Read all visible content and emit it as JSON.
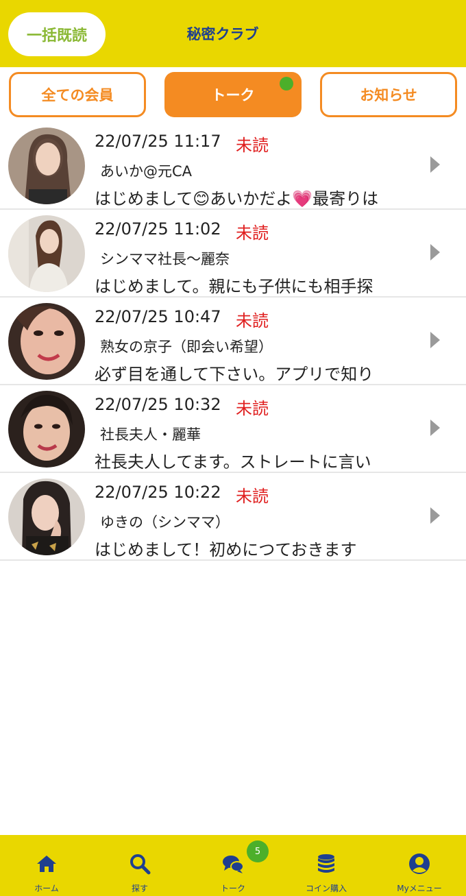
{
  "header": {
    "mark_all_label": "一括既読",
    "title": "秘密クラブ"
  },
  "tabs": [
    {
      "label": "全ての会員",
      "active": false
    },
    {
      "label": "トーク",
      "active": true,
      "has_dot": true
    },
    {
      "label": "お知らせ",
      "active": false
    }
  ],
  "messages": [
    {
      "timestamp": "22/07/25 11:17",
      "status": "未読",
      "name": "あいか@元CA",
      "preview": "はじめまして😊あいかだよ💗最寄りは"
    },
    {
      "timestamp": "22/07/25 11:02",
      "status": "未読",
      "name": "シンママ社長〜麗奈",
      "preview": "はじめまして。親にも子供にも相手探"
    },
    {
      "timestamp": "22/07/25 10:47",
      "status": "未読",
      "name": "熟女の京子（即会い希望）",
      "preview": "必ず目を通して下さい。アプリで知り"
    },
    {
      "timestamp": "22/07/25 10:32",
      "status": "未読",
      "name": "社長夫人・麗華",
      "preview": "社長夫人してます。ストレートに言い"
    },
    {
      "timestamp": "22/07/25 10:22",
      "status": "未読",
      "name": "ゆきの（シンママ）",
      "preview": "はじめまして！初めにつておきます"
    }
  ],
  "bottom_nav": {
    "items": [
      {
        "label": "ホーム",
        "icon": "home-icon"
      },
      {
        "label": "探す",
        "icon": "search-icon"
      },
      {
        "label": "トーク",
        "icon": "chat-icon"
      },
      {
        "label": "コイン購入",
        "icon": "coins-icon"
      },
      {
        "label": "Myメニュー",
        "icon": "user-icon"
      }
    ],
    "talk_badge": "5"
  },
  "colors": {
    "header_bg": "#e9d700",
    "accent_orange": "#f48b22",
    "title_blue": "#1e3f8f",
    "unread_red": "#e02020",
    "badge_green": "#4caf2a"
  }
}
